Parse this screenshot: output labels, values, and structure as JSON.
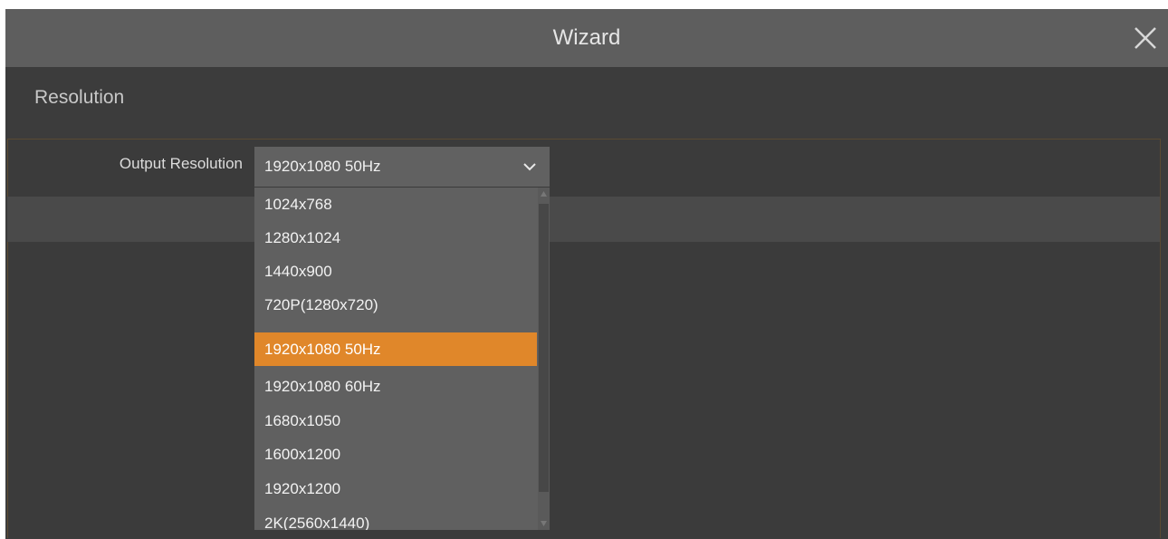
{
  "window": {
    "title": "Wizard",
    "close_icon": "close-icon"
  },
  "section": {
    "title": "Resolution"
  },
  "output_resolution": {
    "label": "Output Resolution",
    "selected_value": "1920x1080 50Hz",
    "options": [
      {
        "label": "1024x768",
        "selected": false
      },
      {
        "label": "1280x1024",
        "selected": false
      },
      {
        "label": "1440x900",
        "selected": false
      },
      {
        "label": "720P(1280x720)",
        "selected": false
      },
      {
        "label": "1920x1080 50Hz",
        "selected": true
      },
      {
        "label": "1920x1080 60Hz",
        "selected": false
      },
      {
        "label": "1680x1050",
        "selected": false
      },
      {
        "label": "1600x1200",
        "selected": false
      },
      {
        "label": "1920x1200",
        "selected": false
      },
      {
        "label": "2K(2560x1440)",
        "selected": false
      }
    ]
  },
  "colors": {
    "accent": "#e0872a",
    "titlebar": "#5e5e5e",
    "background": "#3c3c3c"
  }
}
